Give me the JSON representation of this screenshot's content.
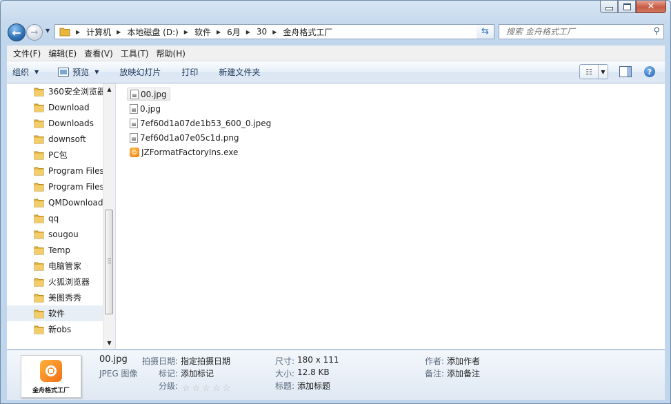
{
  "window": {
    "caption_buttons": [
      "minimize-icon",
      "maximize-icon",
      "close-icon"
    ]
  },
  "nav": {
    "breadcrumbs": [
      "计算机",
      "本地磁盘 (D:)",
      "软件",
      "6月",
      "30",
      "金舟格式工厂"
    ],
    "search_placeholder": "搜索 金舟格式工厂"
  },
  "menu": {
    "items": [
      "文件(F)",
      "编辑(E)",
      "查看(V)",
      "工具(T)",
      "帮助(H)"
    ]
  },
  "toolbar": {
    "organize": "组织",
    "preview": "预览",
    "slideshow": "放映幻灯片",
    "print": "打印",
    "new_folder": "新建文件夹"
  },
  "sidebar": {
    "items": [
      {
        "label": "360安全浏览器"
      },
      {
        "label": "Download"
      },
      {
        "label": "Downloads"
      },
      {
        "label": "downsoft"
      },
      {
        "label": "PC包"
      },
      {
        "label": "Program Files"
      },
      {
        "label": "Program Files"
      },
      {
        "label": "QMDownload"
      },
      {
        "label": "qq"
      },
      {
        "label": "sougou"
      },
      {
        "label": "Temp"
      },
      {
        "label": "电脑管家"
      },
      {
        "label": "火狐浏览器"
      },
      {
        "label": "美图秀秀"
      },
      {
        "label": "软件",
        "selected": true
      },
      {
        "label": "新obs"
      }
    ]
  },
  "files": [
    {
      "name": "00.jpg",
      "icon": "image-file-icon",
      "selected": true
    },
    {
      "name": "0.jpg",
      "icon": "image-file-icon"
    },
    {
      "name": "7ef60d1a07de1b53_600_0.jpeg",
      "icon": "image-file-icon"
    },
    {
      "name": "7ef60d1a07e05c1d.png",
      "icon": "image-file-icon"
    },
    {
      "name": "JZFormatFactoryIns.exe",
      "icon": "app-exe-icon"
    }
  ],
  "details": {
    "thumb_caption": "金舟格式工厂",
    "filename": "00.jpg",
    "filetype": "JPEG 图像",
    "date_taken_label": "拍摄日期:",
    "date_taken_value": "指定拍摄日期",
    "tags_label": "标记:",
    "tags_value": "添加标记",
    "rating_label": "分级:",
    "rating": "☆☆☆☆☆",
    "dimensions_label": "尺寸:",
    "dimensions_value": "180 x 111",
    "size_label": "大小:",
    "size_value": "12.8 KB",
    "title_label": "标题:",
    "title_value": "添加标题",
    "author_label": "作者:",
    "author_value": "添加作者",
    "comments_label": "备注:",
    "comments_value": "添加备注"
  },
  "colors": {
    "accent": "#2d6fb4",
    "selection": "#e8eef5",
    "folder": "#e8b53d"
  }
}
